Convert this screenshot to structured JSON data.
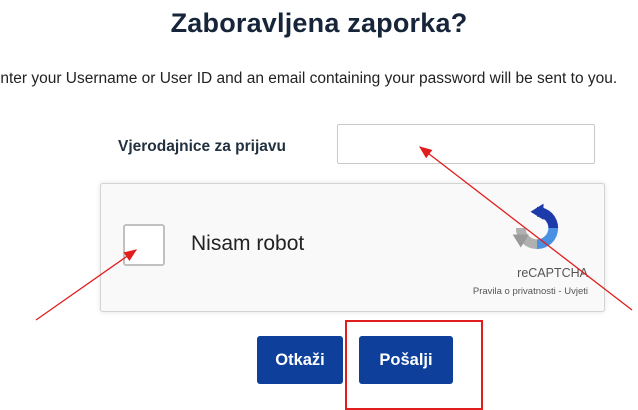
{
  "page": {
    "title": "Zaboravljena zaporka?",
    "instructions": "Enter your Username or User ID and an email containing your password will be sent to you."
  },
  "form": {
    "credentials_label": "Vjerodajnice za prijavu",
    "credentials_value": "",
    "credentials_placeholder": ""
  },
  "recaptcha": {
    "checkbox_label": "Nisam robot",
    "brand": "reCAPTCHA",
    "privacy_label": "Pravila o privatnosti",
    "separator": " - ",
    "terms_label": "Uvjeti",
    "logo_icon": "recaptcha-logo-icon",
    "checked": false
  },
  "buttons": {
    "cancel_label": "Otkaži",
    "submit_label": "Pošalji"
  },
  "colors": {
    "button_bg": "#0d3f9b",
    "annotation": "#e21d1d",
    "title": "#17253a"
  }
}
